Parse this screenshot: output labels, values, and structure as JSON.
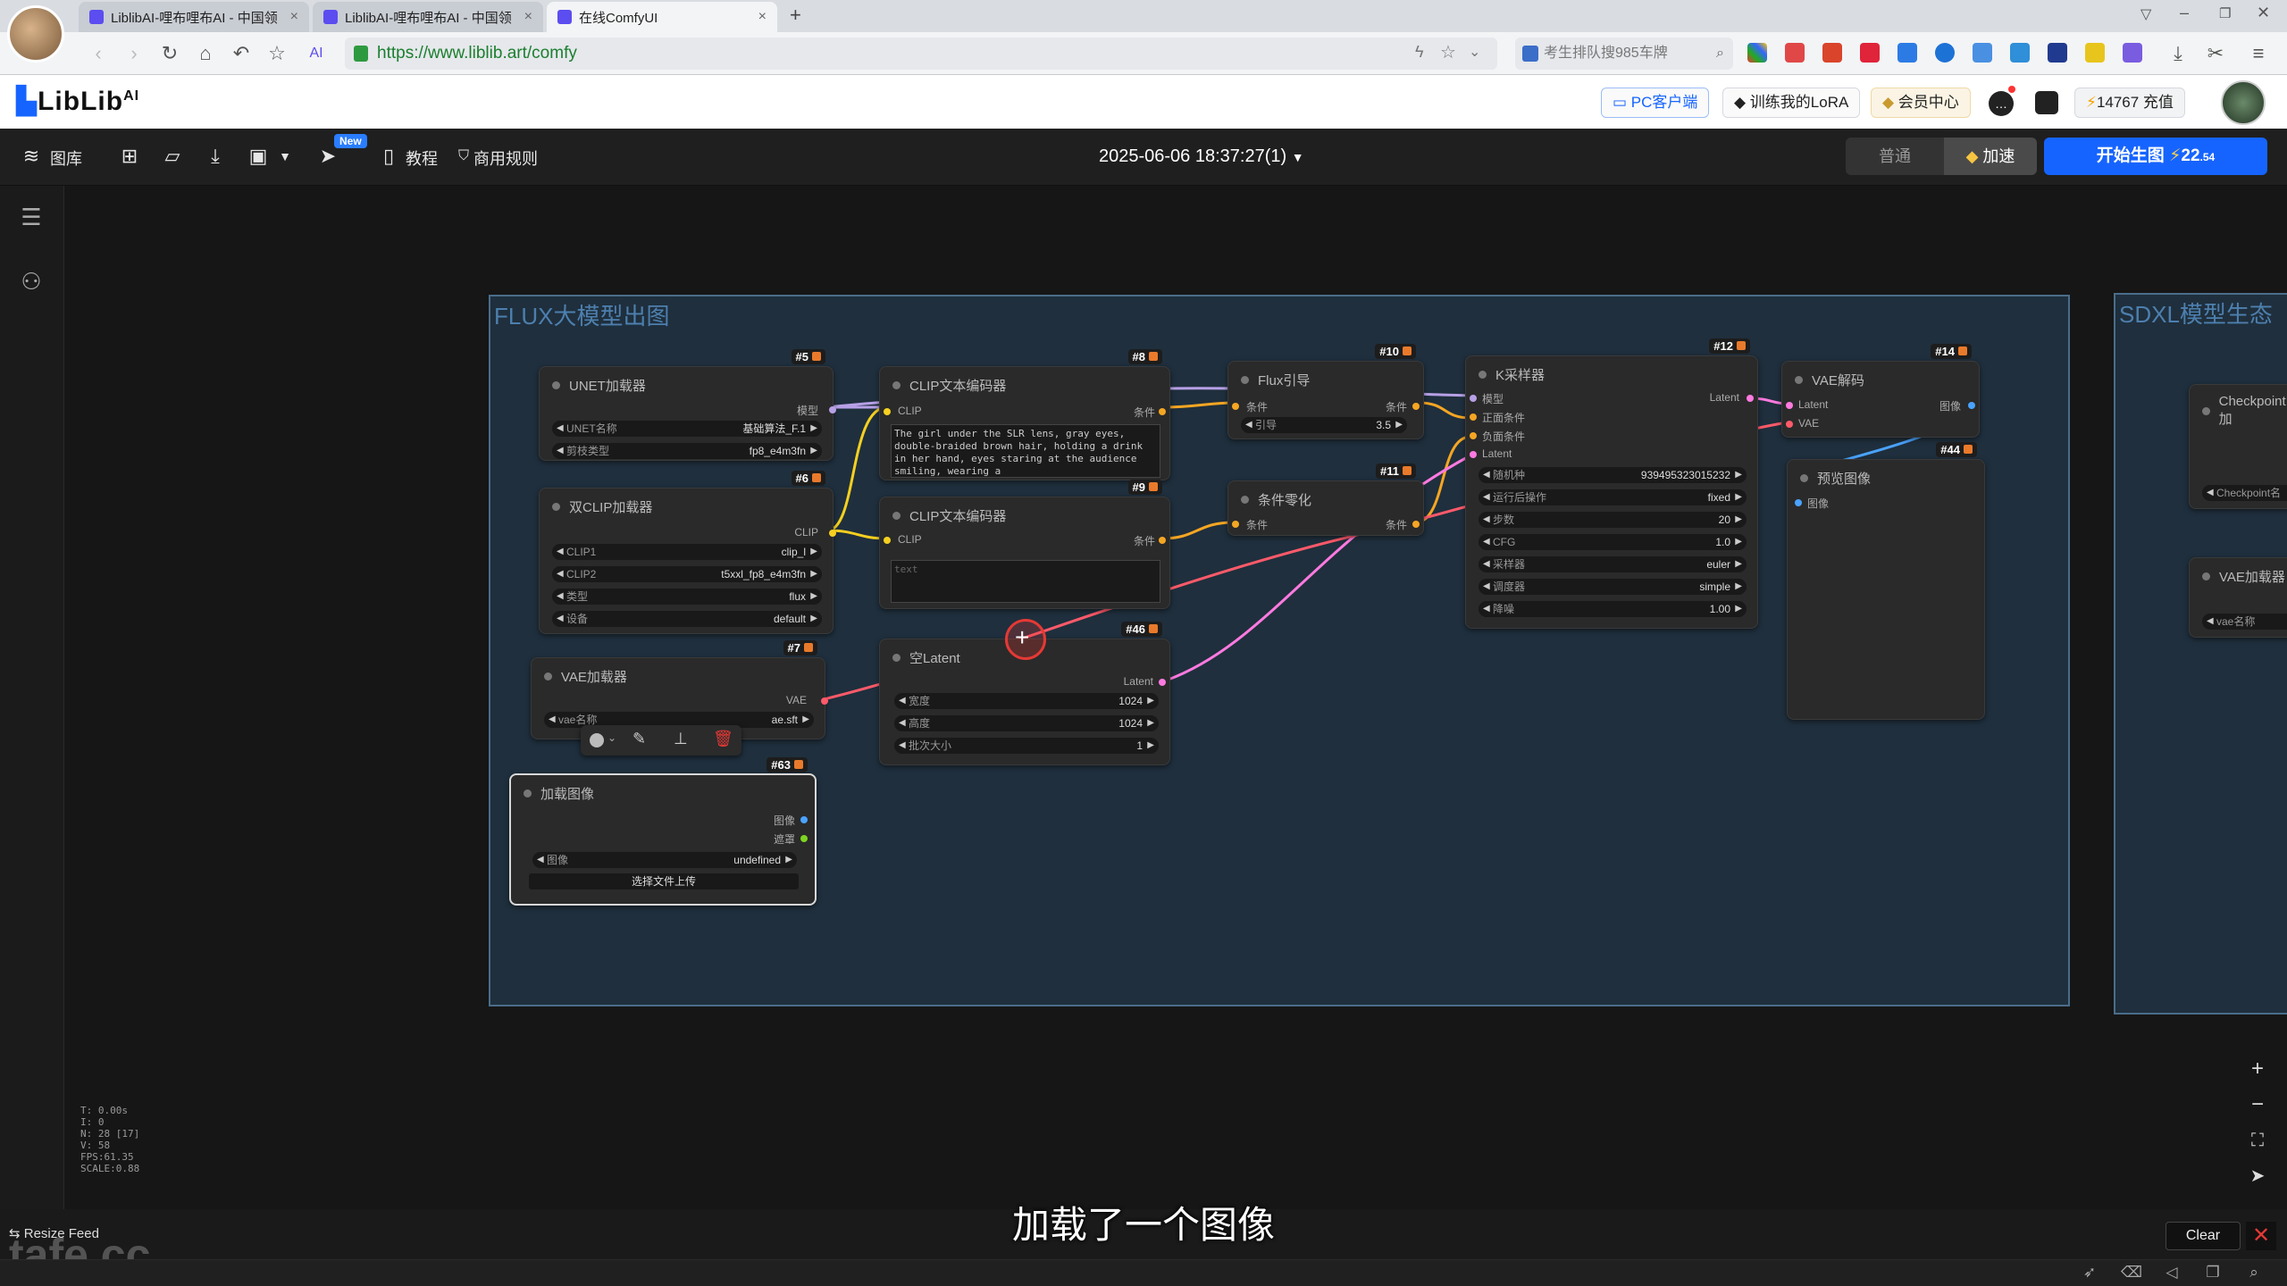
{
  "browser": {
    "tabs": [
      {
        "label": "LiblibAI-哩布哩布AI - 中国领"
      },
      {
        "label": "LiblibAI-哩布哩布AI - 中国领"
      },
      {
        "label": "在线ComfyUI"
      }
    ],
    "url": "https://www.liblib.art/comfy",
    "search_placeholder": "考生排队搜985车牌"
  },
  "site": {
    "logo": "LibLib",
    "logo_ai": "AI",
    "pc_client": "PC客户端",
    "train_lora": "训练我的LoRA",
    "member_center": "会员中心",
    "credits": "14767 充值"
  },
  "toolbar": {
    "library": "图库",
    "new_badge": "New",
    "tutorial": "教程",
    "commercial_rules": "商用规则",
    "workflow_name": "2025-06-06 18:37:27(1)",
    "mode_normal": "普通",
    "mode_fast": "加速",
    "generate": "开始生图",
    "generate_cost": "22",
    "generate_cost_small": ".54"
  },
  "groups": {
    "flux_title": "FLUX大模型出图",
    "sdxl_title": "SDXL模型生态"
  },
  "nodes": {
    "unet": {
      "badge": "#5",
      "title": "UNET加载器",
      "out": "模型",
      "w1_label": "UNET名称",
      "w1_value": "基础算法_F.1",
      "w2_label": "剪枝类型",
      "w2_value": "fp8_e4m3fn"
    },
    "dualclip": {
      "badge": "#6",
      "title": "双CLIP加载器",
      "out": "CLIP",
      "w1_label": "CLIP1",
      "w1_value": "clip_l",
      "w2_label": "CLIP2",
      "w2_value": "t5xxl_fp8_e4m3fn",
      "w3_label": "类型",
      "w3_value": "flux",
      "w4_label": "设备",
      "w4_value": "default"
    },
    "vaeload": {
      "badge": "#7",
      "title": "VAE加载器",
      "out": "VAE",
      "w1_label": "vae名称",
      "w1_value": "ae.sft"
    },
    "loadimg": {
      "badge": "#63",
      "title": "加载图像",
      "out1": "图像",
      "out2": "遮罩",
      "w1_label": "图像",
      "w1_value": "undefined",
      "upload": "选择文件上传"
    },
    "clip8": {
      "badge": "#8",
      "title": "CLIP文本编码器",
      "in": "CLIP",
      "out": "条件",
      "text": "The girl under the SLR lens, gray eyes, double-braided brown hair, holding a drink in her hand, eyes staring at the audience smiling, wearing a"
    },
    "clip9": {
      "badge": "#9",
      "title": "CLIP文本编码器",
      "in": "CLIP",
      "out": "条件",
      "placeholder": "text"
    },
    "latent": {
      "badge": "#46",
      "title": "空Latent",
      "out": "Latent",
      "w1_label": "宽度",
      "w1_value": "1024",
      "w2_label": "高度",
      "w2_value": "1024",
      "w3_label": "批次大小",
      "w3_value": "1"
    },
    "fluxguide": {
      "badge": "#10",
      "title": "Flux引导",
      "in": "条件",
      "out": "条件",
      "w1_label": "引导",
      "w1_value": "3.5"
    },
    "condzero": {
      "badge": "#11",
      "title": "条件零化",
      "in": "条件",
      "out": "条件"
    },
    "ksampler": {
      "badge": "#12",
      "title": "K采样器",
      "out": "Latent",
      "in1": "模型",
      "in2": "正面条件",
      "in3": "负面条件",
      "in4": "Latent",
      "w1_label": "随机种",
      "w1_value": "939495323015232",
      "w2_label": "运行后操作",
      "w2_value": "fixed",
      "w3_label": "步数",
      "w3_value": "20",
      "w4_label": "CFG",
      "w4_value": "1.0",
      "w5_label": "采样器",
      "w5_value": "euler",
      "w6_label": "调度器",
      "w6_value": "simple",
      "w7_label": "降噪",
      "w7_value": "1.00"
    },
    "vaedecode": {
      "badge": "#14",
      "title": "VAE解码",
      "in1": "Latent",
      "in2": "VAE",
      "out": "图像"
    },
    "preview": {
      "badge": "#44",
      "title": "预览图像",
      "in": "图像"
    },
    "ckpt": {
      "title": "Checkpoint加",
      "w1_label": "Checkpoint名"
    },
    "vaeload2": {
      "title": "VAE加载器",
      "w1_label": "vae名称"
    }
  },
  "stats": [
    "T: 0.00s",
    "I: 0",
    "N: 28 [17]",
    "V: 58",
    "FPS:61.35",
    "SCALE:0.88"
  ],
  "subtitle": "加载了一个图像",
  "bottom": {
    "resize_feed": "Resize Feed",
    "clear": "Clear",
    "watermark": "tafe.cc"
  },
  "icons": {
    "zoom_in": "plus-icon",
    "zoom_out": "minus-icon",
    "fit": "fit-view-icon",
    "locate": "locate-icon"
  }
}
